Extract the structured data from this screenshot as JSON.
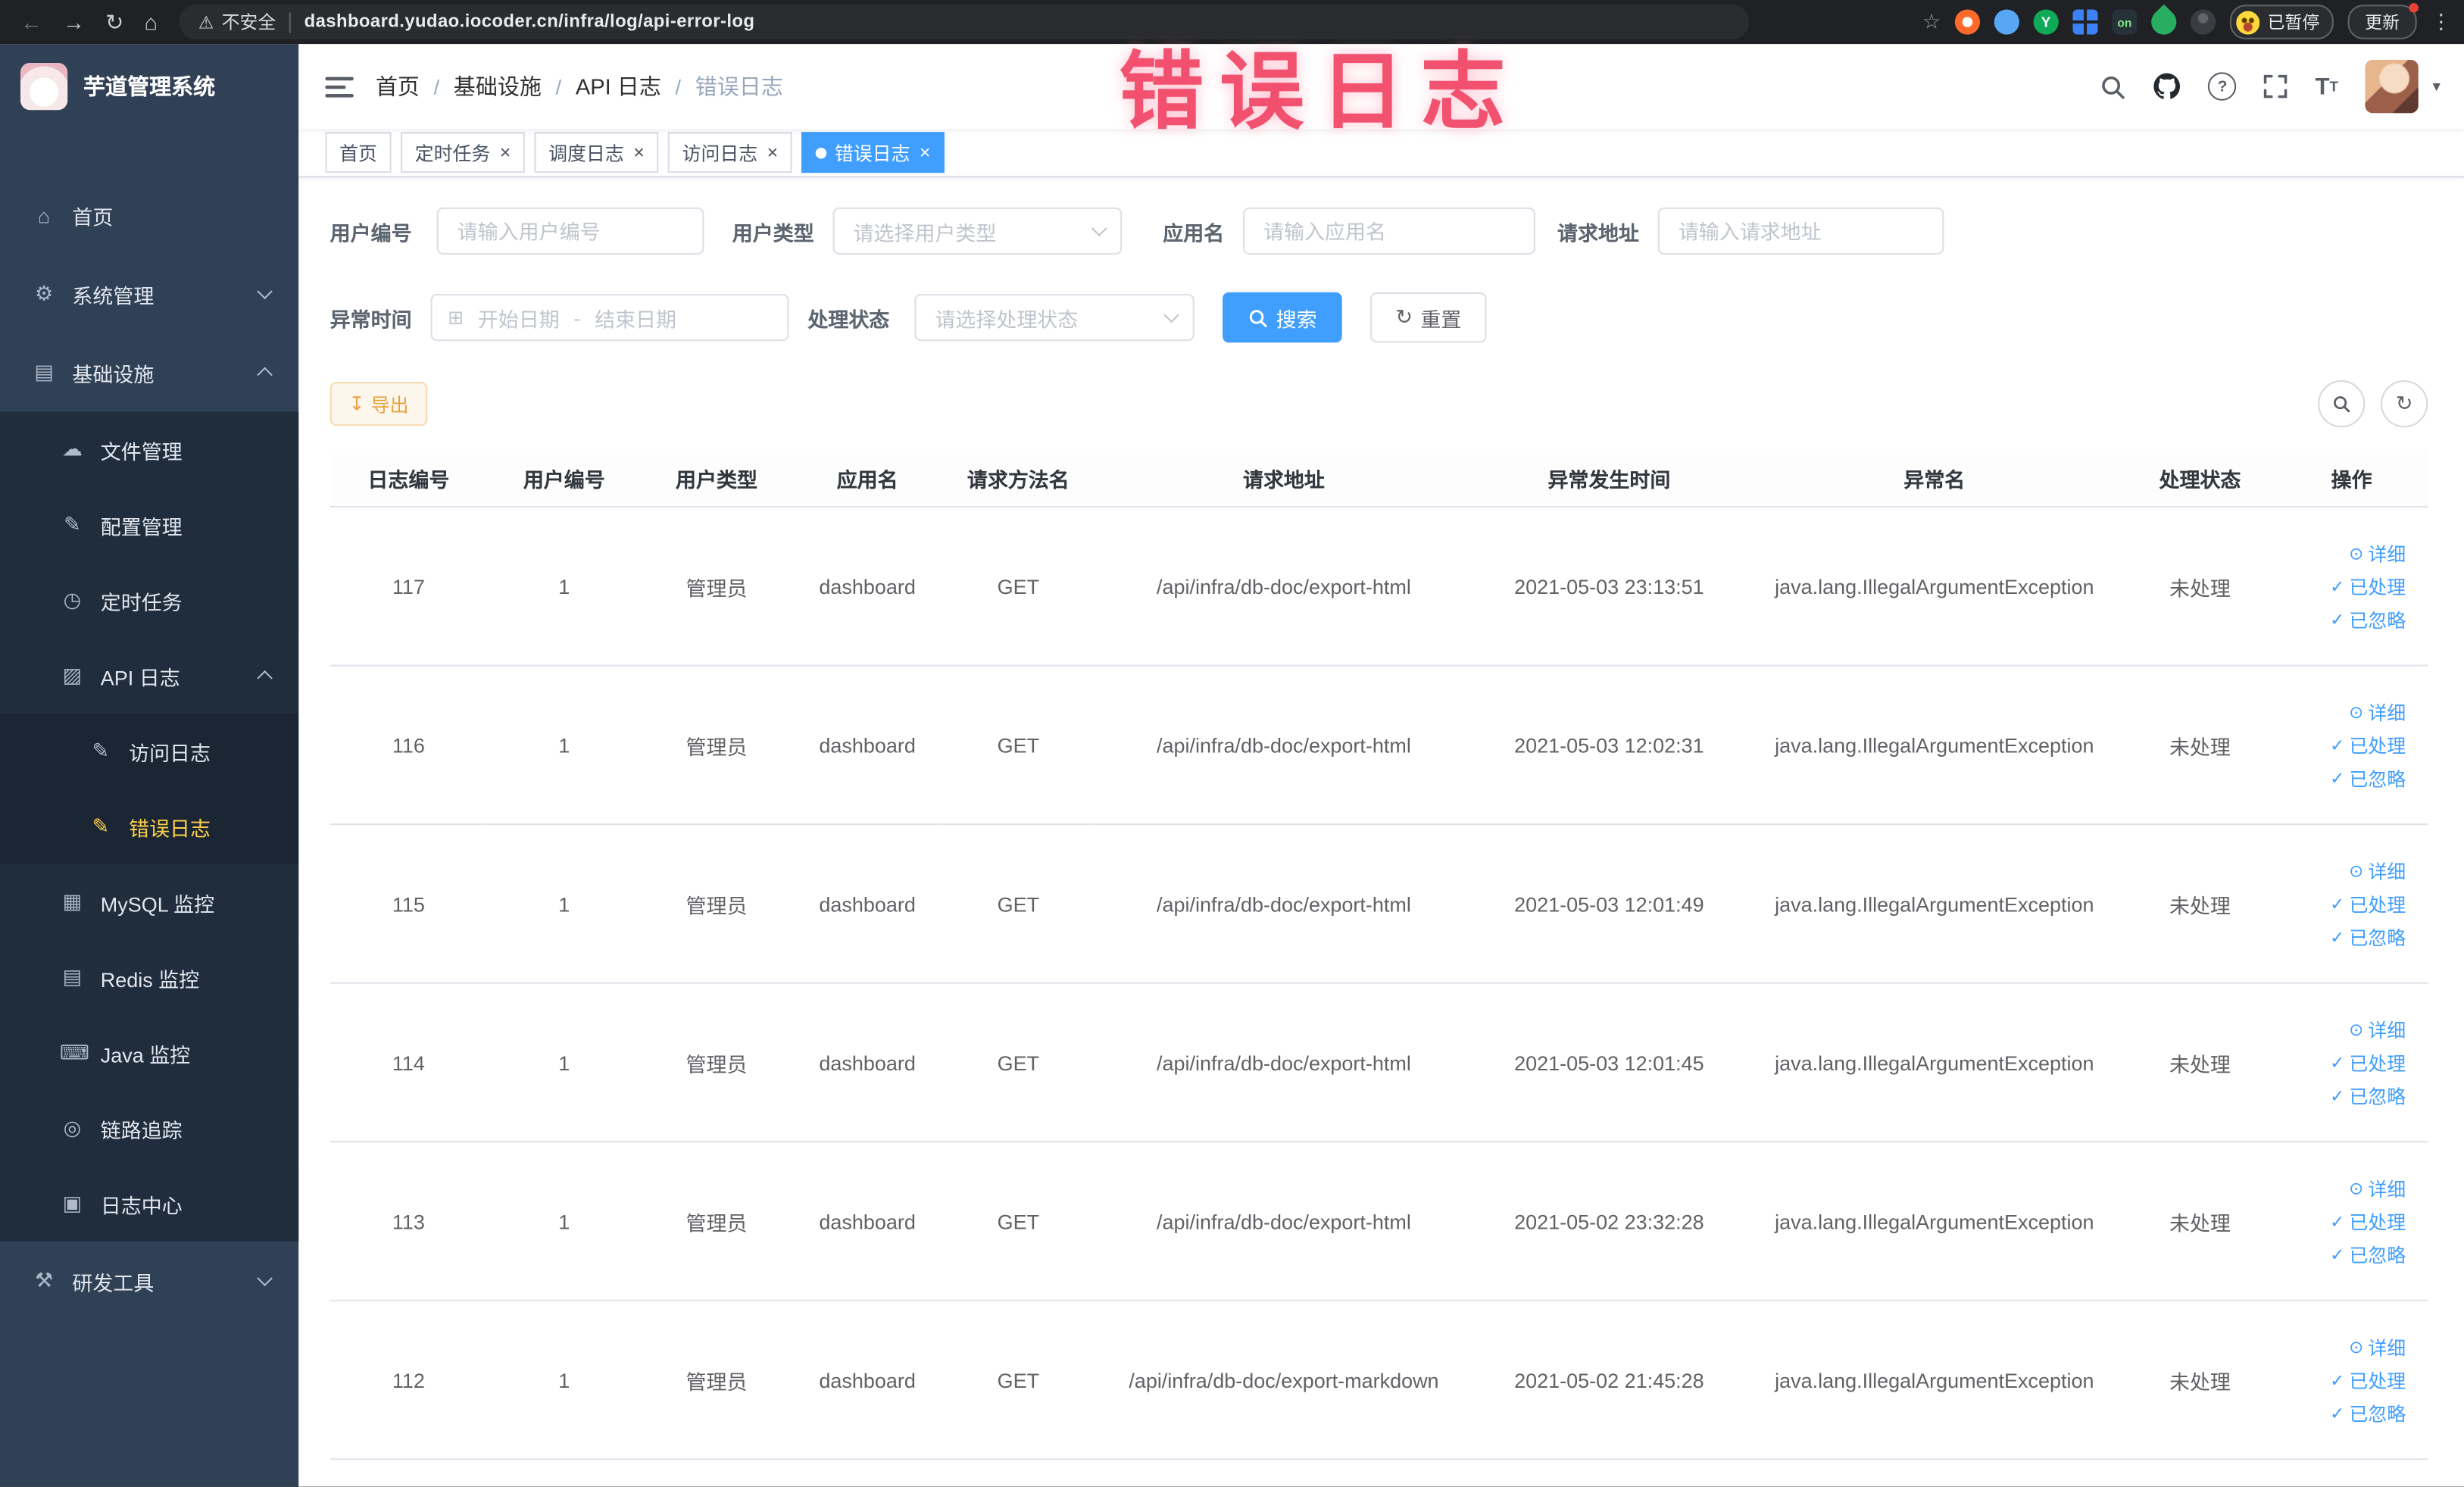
{
  "icons": {
    "back": "←",
    "forward": "→",
    "reload": "↻",
    "home": "⌂",
    "warning": "⚠",
    "star": "☆",
    "kebab": "⋮",
    "caret_down": "▾",
    "check": "✓",
    "eye": "⊙",
    "download": "↧",
    "calendar": "⊞",
    "refresh": "↻",
    "close": "×",
    "help": "?",
    "size_big": "T",
    "size_small": "T"
  },
  "chrome": {
    "security_label": "不安全",
    "url": "dashboard.yudao.iocoder.cn/infra/log/api-error-log",
    "extension_y": "Y",
    "extension_on": "on",
    "paused_badge": "已暂停",
    "update_button": "更新"
  },
  "sidebar": {
    "title": "芋道管理系统",
    "items": [
      {
        "glyph": "⌂",
        "label": "首页"
      },
      {
        "glyph": "⚙",
        "label": "系统管理"
      },
      {
        "glyph": "▤",
        "label": "基础设施"
      },
      {
        "glyph": "☁",
        "label": "文件管理"
      },
      {
        "glyph": "✎",
        "label": "配置管理"
      },
      {
        "glyph": "◷",
        "label": "定时任务"
      },
      {
        "glyph": "▨",
        "label": "API 日志"
      },
      {
        "glyph": "✎",
        "label": "访问日志"
      },
      {
        "glyph": "✎",
        "label": "错误日志"
      },
      {
        "glyph": "▦",
        "label": "MySQL 监控"
      },
      {
        "glyph": "▤",
        "label": "Redis 监控"
      },
      {
        "glyph": "⌨",
        "label": "Java 监控"
      },
      {
        "glyph": "◎",
        "label": "链路追踪"
      },
      {
        "glyph": "▣",
        "label": "日志中心"
      },
      {
        "glyph": "⚒",
        "label": "研发工具"
      }
    ]
  },
  "navbar": {
    "breadcrumb": [
      "首页",
      "基础设施",
      "API 日志",
      "错误日志"
    ],
    "separator": "/"
  },
  "annotation": "错误日志",
  "tagsbar": {
    "tabs": [
      {
        "label": "首页"
      },
      {
        "label": "定时任务"
      },
      {
        "label": "调度日志"
      },
      {
        "label": "访问日志"
      },
      {
        "label": "错误日志"
      }
    ]
  },
  "filters": {
    "user_id": {
      "label": "用户编号",
      "placeholder": "请输入用户编号"
    },
    "user_type": {
      "label": "用户类型",
      "placeholder": "请选择用户类型"
    },
    "app_name": {
      "label": "应用名",
      "placeholder": "请输入应用名"
    },
    "request_url": {
      "label": "请求地址",
      "placeholder": "请输入请求地址"
    },
    "exception_time": {
      "label": "异常时间",
      "start_placeholder": "开始日期",
      "separator": "-",
      "end_placeholder": "结束日期"
    },
    "process_status": {
      "label": "处理状态",
      "placeholder": "请选择处理状态"
    },
    "search_button": "搜索",
    "reset_button": "重置"
  },
  "toolbar": {
    "export_button": "导出"
  },
  "table": {
    "headers": [
      "日志编号",
      "用户编号",
      "用户类型",
      "应用名",
      "请求方法名",
      "请求地址",
      "异常发生时间",
      "异常名",
      "处理状态",
      "操作"
    ],
    "action_labels": [
      "详细",
      "已处理",
      "已忽略"
    ],
    "rows": [
      {
        "id": "117",
        "user_id": "1",
        "user_type": "管理员",
        "app": "dashboard",
        "method": "GET",
        "url": "/api/infra/db-doc/export-html",
        "time": "2021-05-03 23:13:51",
        "exception": "java.lang.IllegalArgumentException",
        "status": "未处理"
      },
      {
        "id": "116",
        "user_id": "1",
        "user_type": "管理员",
        "app": "dashboard",
        "method": "GET",
        "url": "/api/infra/db-doc/export-html",
        "time": "2021-05-03 12:02:31",
        "exception": "java.lang.IllegalArgumentException",
        "status": "未处理"
      },
      {
        "id": "115",
        "user_id": "1",
        "user_type": "管理员",
        "app": "dashboard",
        "method": "GET",
        "url": "/api/infra/db-doc/export-html",
        "time": "2021-05-03 12:01:49",
        "exception": "java.lang.IllegalArgumentException",
        "status": "未处理"
      },
      {
        "id": "114",
        "user_id": "1",
        "user_type": "管理员",
        "app": "dashboard",
        "method": "GET",
        "url": "/api/infra/db-doc/export-html",
        "time": "2021-05-03 12:01:45",
        "exception": "java.lang.IllegalArgumentException",
        "status": "未处理"
      },
      {
        "id": "113",
        "user_id": "1",
        "user_type": "管理员",
        "app": "dashboard",
        "method": "GET",
        "url": "/api/infra/db-doc/export-html",
        "time": "2021-05-02 23:32:28",
        "exception": "java.lang.IllegalArgumentException",
        "status": "未处理"
      },
      {
        "id": "112",
        "user_id": "1",
        "user_type": "管理员",
        "app": "dashboard",
        "method": "GET",
        "url": "/api/infra/db-doc/export-markdown",
        "time": "2021-05-02 21:45:28",
        "exception": "java.lang.IllegalArgumentException",
        "status": "未处理"
      }
    ]
  }
}
